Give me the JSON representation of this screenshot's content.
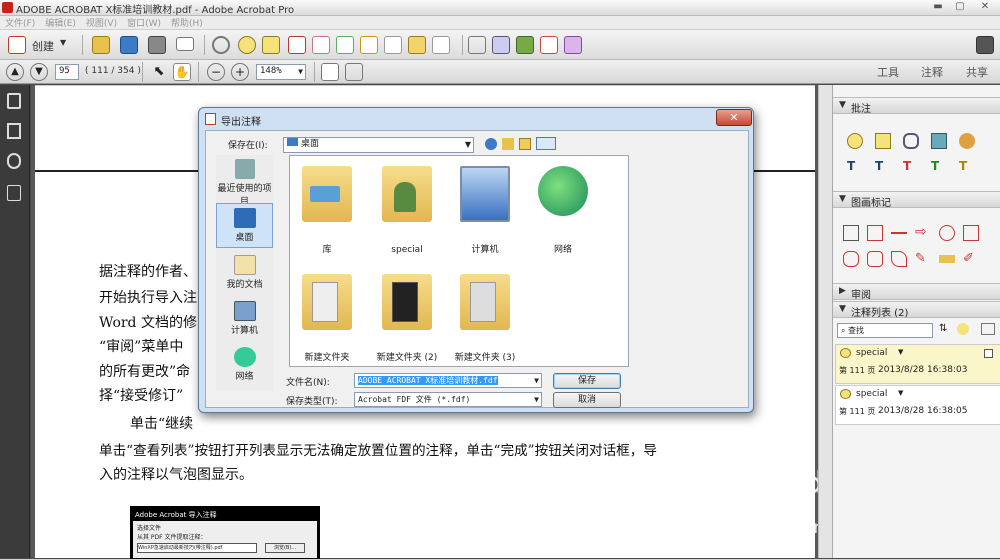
{
  "window": {
    "title": "ADOBE ACROBAT X标准培训教材.pdf - Adobe Acrobat Pro",
    "min": "▬",
    "max": "▢",
    "close": "✕"
  },
  "menu": [
    "文件(F)",
    "编辑(E)",
    "视图(V)",
    "窗口(W)",
    "帮助(H)"
  ],
  "toolbar": {
    "create_label": "创建",
    "page_number": "95",
    "page_count": "( 111 / 354 )",
    "zoom": "148%"
  },
  "tabs": {
    "tools": "工具",
    "comment": "注释",
    "share": "共享"
  },
  "document": {
    "lines": [
      "据注释的作者、",
      "开始执行导入注",
      "Word 文档的修",
      "“审阅”菜单中",
      "的所有更改”命",
      "择“接受修订”"
    ],
    "para2_line1": "单击“继续",
    "para2_line2": "单击“查看列表”按钮打开列表显示无法确定放置位置的注释，单击“完成”按钮关闭对话框，导",
    "para2_line3": "入的注释以气泡图显示。",
    "figure_title": "Adobe Acrobat 导入注释",
    "figure_l1": "选择文件",
    "figure_l2": "从其 PDF 文件提取注释：",
    "figure_l3": "WinXP急速启动最新技巧(带注释).pdf",
    "figure_btn": "浏览(B)..."
  },
  "right_panel": {
    "sec_annotations": "批注",
    "sec_drawing": "图画标记",
    "sec_review": "审阅",
    "sec_comment_list": "注释列表 (2)",
    "search_placeholder": "查找",
    "comments": [
      {
        "author": "special",
        "page": "第 111 页",
        "date": "2013/8/28 16:38:03"
      },
      {
        "author": "special",
        "page": "第 111 页",
        "date": "2013/8/28 16:38:05"
      }
    ]
  },
  "dialog": {
    "title": "导出注释",
    "save_in_label": "保存在(I):",
    "save_in_value": "桌面",
    "places": [
      "最近使用的项目",
      "桌面",
      "我的文档",
      "计算机",
      "网络"
    ],
    "files": [
      "库",
      "special",
      "计算机",
      "网络",
      "新建文件夹",
      "新建文件夹 (2)",
      "新建文件夹 (3)"
    ],
    "filename_label": "文件名(N):",
    "filename_value": "ADOBE ACROBAT X标准培训教材.fdf",
    "filetype_label": "保存类型(T):",
    "filetype_value": "Acrobat FDF 文件 (*.fdf)",
    "save_button": "保存",
    "cancel_button": "取消",
    "close_button": "✕"
  },
  "watermark": {
    "brand": "Bai du 经验",
    "url": "jingyan.baidu.com"
  },
  "colors": {
    "accent": "#3c7fb1",
    "highlight": "#fbf6c9",
    "watermark": "#ffffff"
  }
}
